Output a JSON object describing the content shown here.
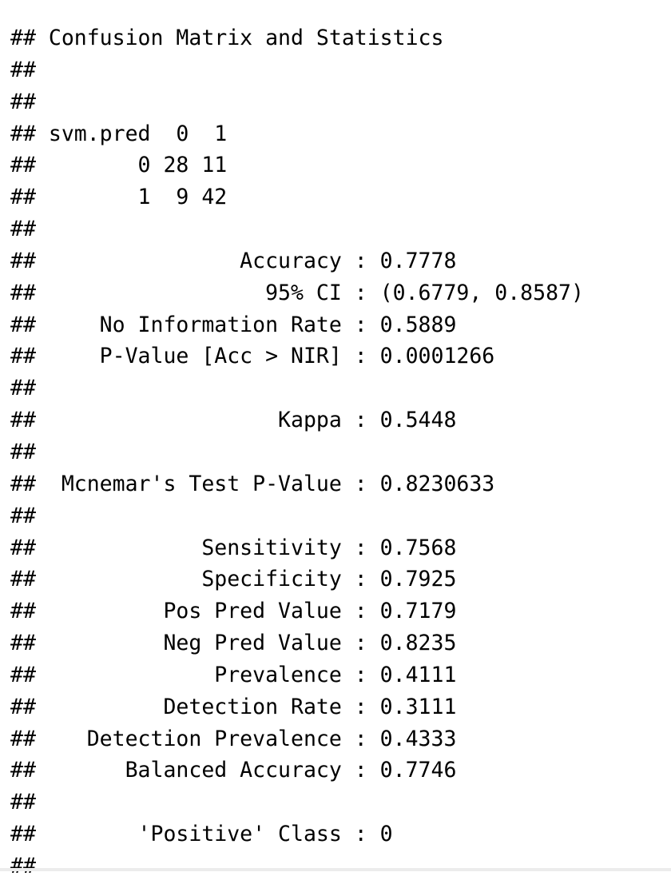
{
  "console_output": {
    "lines": [
      "## Confusion Matrix and Statistics",
      "##",
      "##",
      "## svm.pred  0  1",
      "##        0 28 11",
      "##        1  9 42",
      "##",
      "##                Accuracy : 0.7778",
      "##                  95% CI : (0.6779, 0.8587)",
      "##     No Information Rate : 0.5889",
      "##     P-Value [Acc > NIR] : 0.0001266",
      "##",
      "##                   Kappa : 0.5448",
      "##",
      "##  Mcnemar's Test P-Value : 0.8230633",
      "##",
      "##             Sensitivity : 0.7568",
      "##             Specificity : 0.7925",
      "##          Pos Pred Value : 0.7179",
      "##          Neg Pred Value : 0.8235",
      "##              Prevalence : 0.4111",
      "##          Detection Rate : 0.3111",
      "##    Detection Prevalence : 0.4333",
      "##       Balanced Accuracy : 0.7746",
      "##",
      "##        'Positive' Class : 0",
      "##"
    ]
  }
}
